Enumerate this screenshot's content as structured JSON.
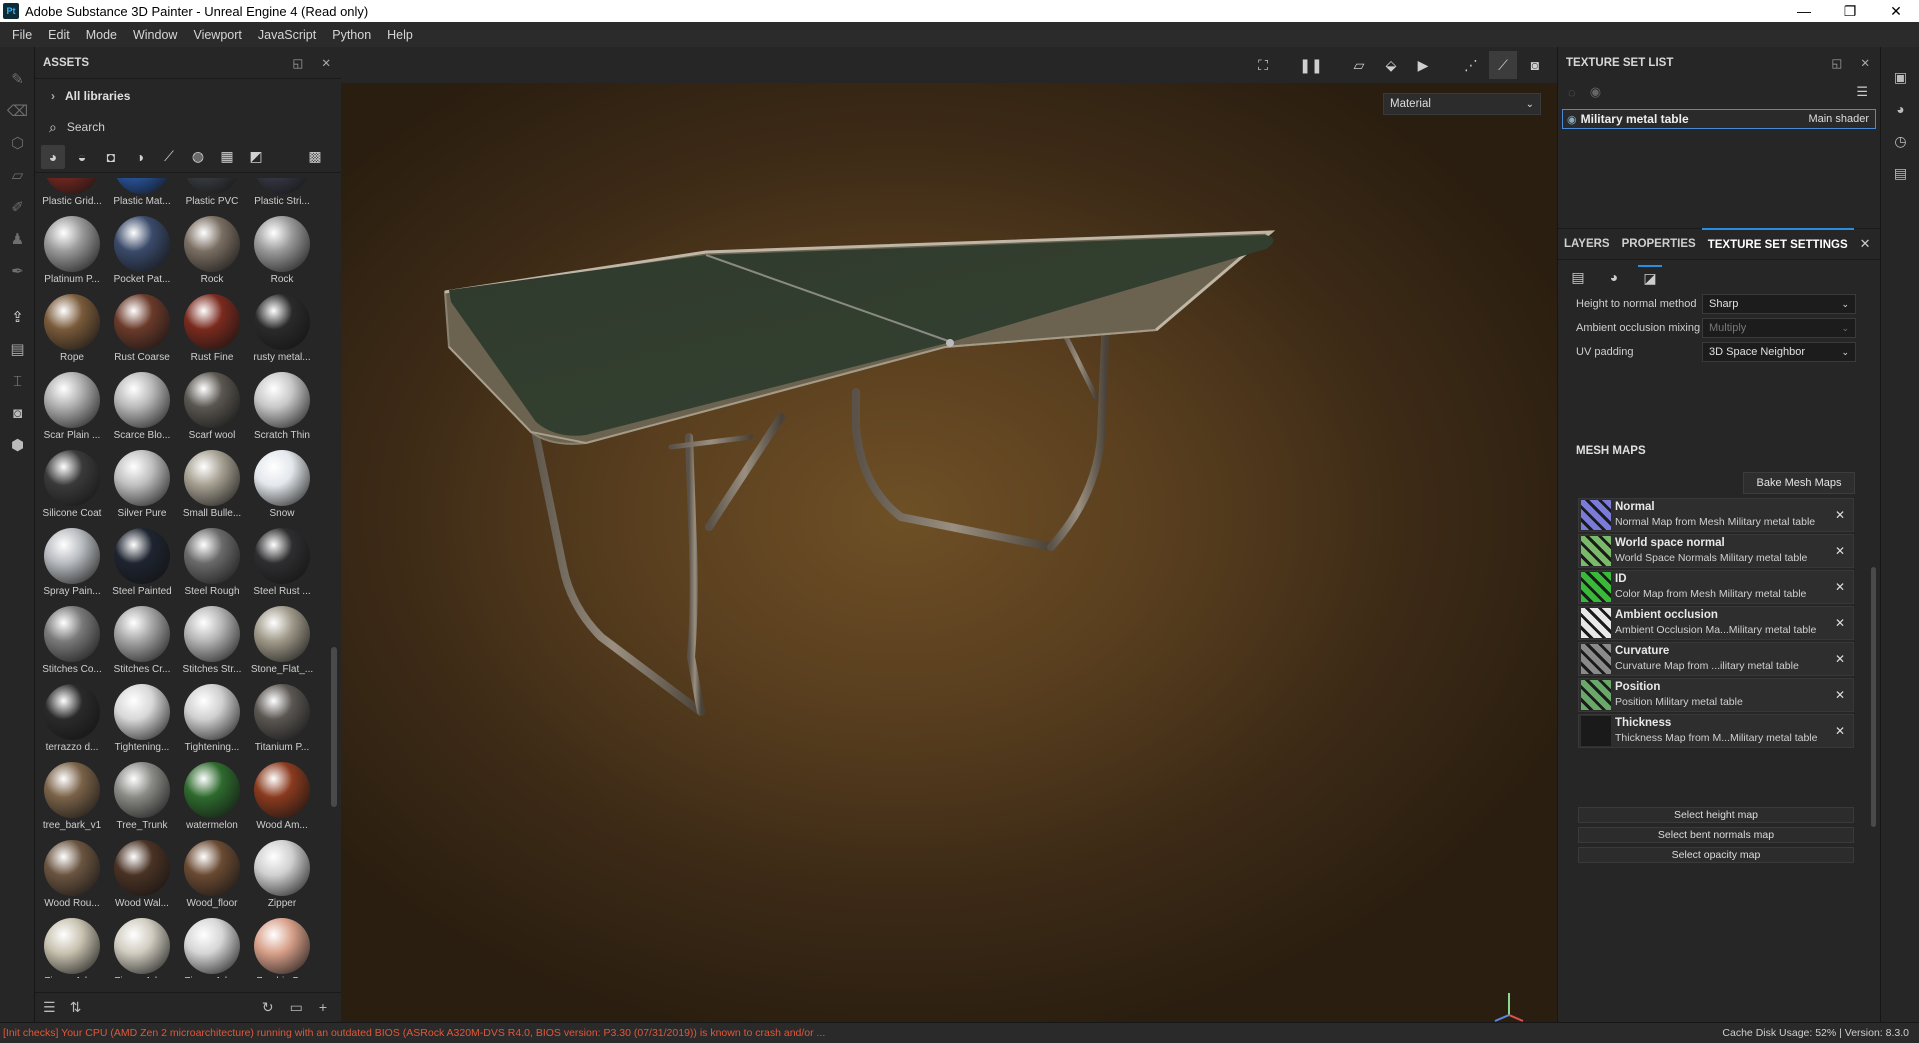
{
  "window": {
    "title": "Adobe Substance 3D Painter - Unreal Engine 4 (Read only)",
    "app_icon": "Pt"
  },
  "menu": [
    "File",
    "Edit",
    "Mode",
    "Window",
    "Viewport",
    "JavaScript",
    "Python",
    "Help"
  ],
  "assets": {
    "title": "ASSETS",
    "libraries_label": "All libraries",
    "search_placeholder": "Search",
    "items": [
      {
        "label": "Plastic Grid...",
        "color": "#7a2a22"
      },
      {
        "label": "Plastic Mat...",
        "color": "#2a5aa8"
      },
      {
        "label": "Plastic PVC",
        "color": "#3a3f44"
      },
      {
        "label": "Plastic Stri...",
        "color": "#3a3a4a"
      },
      {
        "label": "Platinum P...",
        "color": "#9a9a9a"
      },
      {
        "label": "Pocket Pat...",
        "color": "#3a4a6a"
      },
      {
        "label": "Rock",
        "color": "#7a6e62"
      },
      {
        "label": "Rock",
        "color": "#9a9a9a"
      },
      {
        "label": "Rope",
        "color": "#7a5a3a"
      },
      {
        "label": "Rust Coarse",
        "color": "#6a3a2a"
      },
      {
        "label": "Rust Fine",
        "color": "#7a2a1e"
      },
      {
        "label": "rusty metal...",
        "color": "#2a2a2a"
      },
      {
        "label": "Scar Plain ...",
        "color": "#b0b0b0"
      },
      {
        "label": "Scarce Blo...",
        "color": "#bababa"
      },
      {
        "label": "Scarf wool",
        "color": "#5a5650"
      },
      {
        "label": "Scratch Thin",
        "color": "#c8c8c8"
      },
      {
        "label": "Silicone Coat",
        "color": "#3a3a3a"
      },
      {
        "label": "Silver Pure",
        "color": "#c0c0c0"
      },
      {
        "label": "Small Bulle...",
        "color": "#a6a092"
      },
      {
        "label": "Snow",
        "color": "#e4e8ec"
      },
      {
        "label": "Spray Pain...",
        "color": "#b8bcc0"
      },
      {
        "label": "Steel Painted",
        "color": "#1e2430"
      },
      {
        "label": "Steel Rough",
        "color": "#6a6a6a"
      },
      {
        "label": "Steel Rust ...",
        "color": "#2e2e30"
      },
      {
        "label": "Stitches Co...",
        "color": "#7a7a7a"
      },
      {
        "label": "Stitches Cr...",
        "color": "#a6a6a6"
      },
      {
        "label": "Stitches Str...",
        "color": "#b6b6b6"
      },
      {
        "label": "Stone_Flat_...",
        "color": "#a09a8a"
      },
      {
        "label": "terrazzo d...",
        "color": "#2a2a2a"
      },
      {
        "label": "Tightening...",
        "color": "#d8d8d8"
      },
      {
        "label": "Tightening...",
        "color": "#d0d0d0"
      },
      {
        "label": "Titanium P...",
        "color": "#5a5652"
      },
      {
        "label": "tree_bark_v1",
        "color": "#7a6248"
      },
      {
        "label": "Tree_Trunk",
        "color": "#8a8a86"
      },
      {
        "label": "watermelon",
        "color": "#2e6a2e"
      },
      {
        "label": "Wood Am...",
        "color": "#8a3a1e"
      },
      {
        "label": "Wood Rou...",
        "color": "#6a5440"
      },
      {
        "label": "Wood Wal...",
        "color": "#4a3224"
      },
      {
        "label": "Wood_floor",
        "color": "#6a4a32"
      },
      {
        "label": "Zipper",
        "color": "#d0d0d0"
      },
      {
        "label": "Zipper Adv...",
        "color": "#c8c2b0"
      },
      {
        "label": "Zipper Adv...",
        "color": "#d0ccc0"
      },
      {
        "label": "Zipper Adv...",
        "color": "#d6d6d6"
      },
      {
        "label": "Zombie B...",
        "color": "#d8a08a"
      }
    ]
  },
  "viewport": {
    "mode_select": "Material"
  },
  "texture_set_list": {
    "title": "TEXTURE SET LIST",
    "item_name": "Military metal table",
    "item_shader": "Main shader"
  },
  "tabs": [
    {
      "label": "LAYERS"
    },
    {
      "label": "PROPERTIES"
    },
    {
      "label": "TEXTURE SET SETTINGS"
    }
  ],
  "settings": [
    {
      "label": "Height to normal method",
      "value": "Sharp"
    },
    {
      "label": "Ambient occlusion mixing",
      "value": "Multiply"
    },
    {
      "label": "UV padding",
      "value": "3D Space Neighbor"
    }
  ],
  "mesh_maps": {
    "title": "MESH MAPS",
    "bake_label": "Bake Mesh Maps",
    "items": [
      {
        "title": "Normal",
        "subtitle": "Normal Map from Mesh Military metal table",
        "color": "#7a7ad8"
      },
      {
        "title": "World space normal",
        "subtitle": "World Space Normals Military metal table",
        "color": "#7ab86a"
      },
      {
        "title": "ID",
        "subtitle": "Color Map from Mesh Military metal table",
        "color": "#3ab83a"
      },
      {
        "title": "Ambient occlusion",
        "subtitle": "Ambient Occlusion Ma...Military metal table",
        "color": "#e8e8e8"
      },
      {
        "title": "Curvature",
        "subtitle": "Curvature Map from ...ilitary metal table",
        "color": "#8a8a8a"
      },
      {
        "title": "Position",
        "subtitle": "Position Military metal table",
        "color": "#6aa86a"
      },
      {
        "title": "Thickness",
        "subtitle": "Thickness Map from M...Military metal table",
        "color": "#1a1a1a"
      }
    ],
    "select_buttons": [
      "Select height map",
      "Select bent normals map",
      "Select opacity map"
    ]
  },
  "statusbar": {
    "message": "[Init checks] Your CPU (AMD Zen 2 microarchitecture) running with an outdated BIOS (ASRock A320M-DVS R4.0, BIOS version: P3.30 (07/31/2019)) is known to crash and/or ...",
    "cache": "Cache Disk Usage:   52% | Version: 8.3.0"
  }
}
